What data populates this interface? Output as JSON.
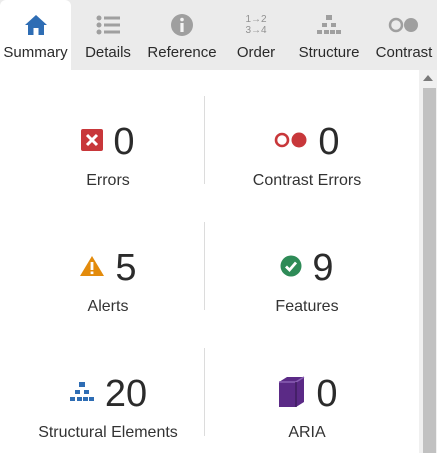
{
  "tabs": [
    {
      "label": "Summary",
      "icon": "home-icon",
      "active": true
    },
    {
      "label": "Details",
      "icon": "list-icon",
      "active": false
    },
    {
      "label": "Reference",
      "icon": "info-icon",
      "active": false
    },
    {
      "label": "Order",
      "icon": "order-icon",
      "active": false
    },
    {
      "label": "Structure",
      "icon": "structure-icon",
      "active": false
    },
    {
      "label": "Contrast",
      "icon": "contrast-icon",
      "active": false
    }
  ],
  "order_icon_text": {
    "top": "1→2",
    "bottom": "3→4"
  },
  "summary": {
    "errors": {
      "count": "0",
      "label": "Errors",
      "icon": "error-x-icon"
    },
    "contrast_errors": {
      "count": "0",
      "label": "Contrast Errors",
      "icon": "contrast-errors-icon"
    },
    "alerts": {
      "count": "5",
      "label": "Alerts",
      "icon": "alert-triangle-icon"
    },
    "features": {
      "count": "9",
      "label": "Features",
      "icon": "feature-check-icon"
    },
    "structural": {
      "count": "20",
      "label": "Structural Elements",
      "icon": "structure-icon"
    },
    "aria": {
      "count": "0",
      "label": "ARIA",
      "icon": "aria-cube-icon"
    }
  },
  "colors": {
    "accent": "#2e6db4",
    "error": "#c8373a",
    "alert": "#e38b0c",
    "feature": "#2e8b57",
    "aria": "#5b2a86"
  }
}
